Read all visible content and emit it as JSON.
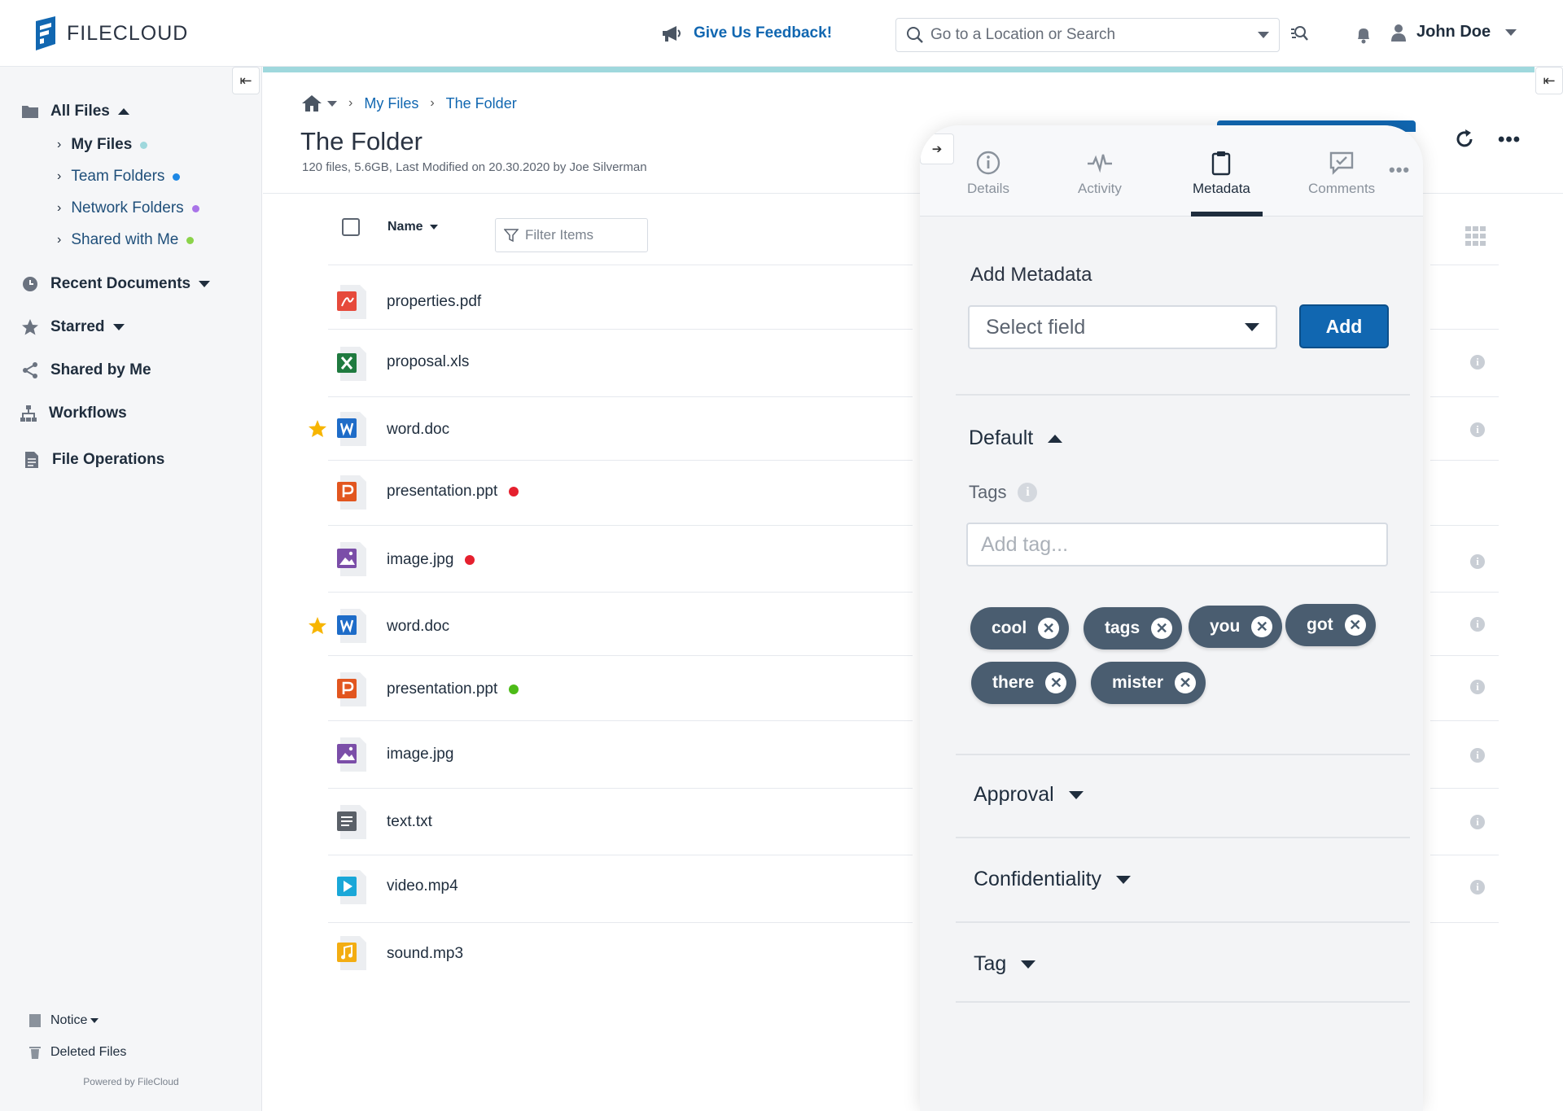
{
  "app": {
    "logo_text": "FILECLOUD"
  },
  "header": {
    "feedback_label": "Give Us Feedback!",
    "search_placeholder": "Go to a Location or Search",
    "user_name": "John Doe"
  },
  "sidebar": {
    "all_files": "All Files",
    "sub_items": [
      {
        "label": "My Files",
        "dot_color": "#9fd8dd"
      },
      {
        "label": "Team Folders",
        "dot_color": "#1e88e5"
      },
      {
        "label": "Network Folders",
        "dot_color": "#a974e8"
      },
      {
        "label": "Shared with Me",
        "dot_color": "#8bd34a"
      }
    ],
    "recent_documents": "Recent Documents",
    "starred": "Starred",
    "shared_by_me": "Shared by Me",
    "workflows": "Workflows",
    "file_operations": "File Operations",
    "notice": "Notice",
    "deleted_files": "Deleted Files",
    "powered_by": "Powered by FileCloud"
  },
  "breadcrumb": {
    "items": [
      "My Files",
      "The Folder"
    ]
  },
  "folder": {
    "title": "The Folder",
    "subtitle": "120 files, 5.6GB, Last Modified on 20.30.2020 by Joe Silverman"
  },
  "list": {
    "name_header": "Name",
    "filter_placeholder": "Filter Items",
    "files": [
      {
        "name": "properties.pdf",
        "type": "pdf",
        "starred": false,
        "status_color": null
      },
      {
        "name": "proposal.xls",
        "type": "xls",
        "starred": false,
        "status_color": null
      },
      {
        "name": "word.doc",
        "type": "doc",
        "starred": true,
        "status_color": null
      },
      {
        "name": "presentation.ppt",
        "type": "ppt",
        "starred": false,
        "status_color": "#e5202e"
      },
      {
        "name": "image.jpg",
        "type": "jpg",
        "starred": false,
        "status_color": "#e5202e"
      },
      {
        "name": "word.doc",
        "type": "doc",
        "starred": true,
        "status_color": null
      },
      {
        "name": "presentation.ppt",
        "type": "ppt",
        "starred": false,
        "status_color": "#4cbb17"
      },
      {
        "name": "image.jpg",
        "type": "jpg",
        "starred": false,
        "status_color": null
      },
      {
        "name": "text.txt",
        "type": "txt",
        "starred": false,
        "status_color": null
      },
      {
        "name": "video.mp4",
        "type": "mp4",
        "starred": false,
        "status_color": null
      },
      {
        "name": "sound.mp3",
        "type": "mp3",
        "starred": false,
        "status_color": null
      }
    ]
  },
  "panel": {
    "tabs": [
      {
        "label": "Details",
        "icon": "info-icon"
      },
      {
        "label": "Activity",
        "icon": "activity-icon"
      },
      {
        "label": "Metadata",
        "icon": "clipboard-icon",
        "active": true
      },
      {
        "label": "Comments",
        "icon": "comment-icon"
      }
    ],
    "add_metadata_title": "Add Metadata",
    "select_field_label": "Select field",
    "add_button": "Add",
    "default_section": "Default",
    "tags_label": "Tags",
    "tag_placeholder": "Add tag...",
    "tags": [
      "cool",
      "tags",
      "you",
      "got",
      "there",
      "mister"
    ],
    "sections": [
      "Approval",
      "Confidentiality",
      "Tag"
    ]
  },
  "colors": {
    "accent": "#1167b1",
    "progress": "#9fd8dd",
    "chip": "#4a5d70"
  }
}
